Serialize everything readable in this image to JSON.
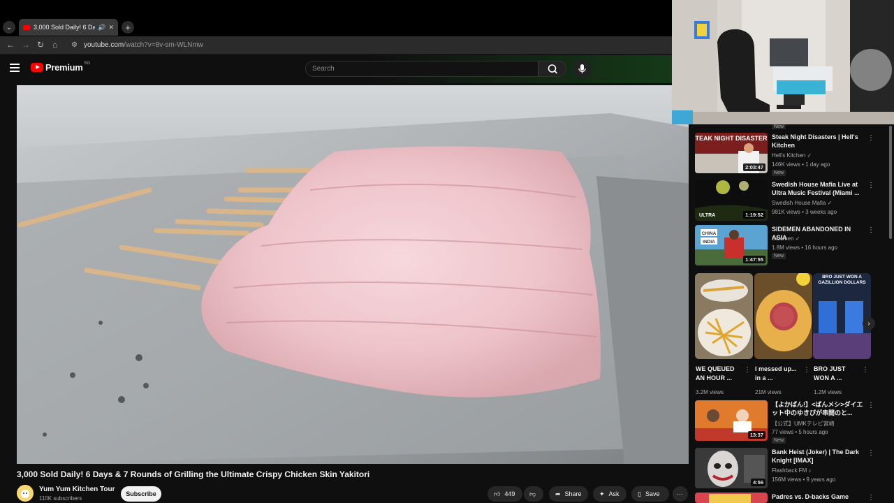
{
  "browser": {
    "tab_title": "3,000 Sold Daily! 6 Days &",
    "url_host": "youtube.com",
    "url_path": "/watch?v=8v-sm-WLNmw"
  },
  "header": {
    "logo_text": "Premium",
    "country_code": "SG",
    "search_placeholder": "Search"
  },
  "video": {
    "title": "3,000 Sold Daily! 6 Days & 7 Rounds of Grilling the Ultimate Crispy Chicken Skin Yakitori",
    "channel": "Yum Yum Kitchen Tour",
    "subscribers": "110K subscribers",
    "subscribe_label": "Subscribe",
    "likes": "449",
    "share_label": "Share",
    "ask_label": "Ask",
    "save_label": "Save"
  },
  "sidebar": {
    "top_badge": "New",
    "recommendations": [
      {
        "title": "Steak Night Disasters | Hell's Kitchen",
        "channel": "Hell's Kitchen",
        "meta": "146K views • 1 day ago",
        "duration": "2:03:47",
        "badge": "New"
      },
      {
        "title": "Swedish House Mafia Live at Ultra Music Festival (Miami ...",
        "channel": "Swedish House Mafia",
        "meta": "981K views • 3 weeks ago",
        "duration": "1:19:52",
        "badge": ""
      },
      {
        "title": "SIDEMEN ABANDONED IN ASIA",
        "channel": "Sidemen",
        "meta": "1.8M views • 16 hours ago",
        "duration": "1:47:55",
        "badge": "New"
      }
    ],
    "shorts": [
      {
        "title": "WE QUEUED AN HOUR ...",
        "views": "3.2M views"
      },
      {
        "title": "I messed up... in a ...",
        "views": "21M views"
      },
      {
        "title": "BRO JUST WON A ...",
        "views": "1.2M views"
      }
    ],
    "recommendations2": [
      {
        "title": "【よかばん!】<ばんメシ>ダイエット中のゆきぴが串間のと...",
        "channel": "【公式】UMKテレビ宮崎",
        "meta": "77 views • 5 hours ago",
        "duration": "13:37",
        "badge": "New"
      },
      {
        "title": "Bank Heist (Joker) | The Dark Knight [IMAX]",
        "channel": "Flashback FM",
        "meta": "156M views • 9 years ago",
        "duration": "4:56",
        "badge": ""
      },
      {
        "title": "Padres vs. D-backs Game",
        "channel": "",
        "meta": "",
        "duration": "",
        "badge": ""
      }
    ]
  },
  "thumb_text": {
    "steak": "STEAK NIGHT DISASTERS",
    "china": "CHINA",
    "india": "INDIA",
    "ultra": "ULTRA",
    "bro": "BRO JUST WON A GAZILLION DOLLARS"
  }
}
